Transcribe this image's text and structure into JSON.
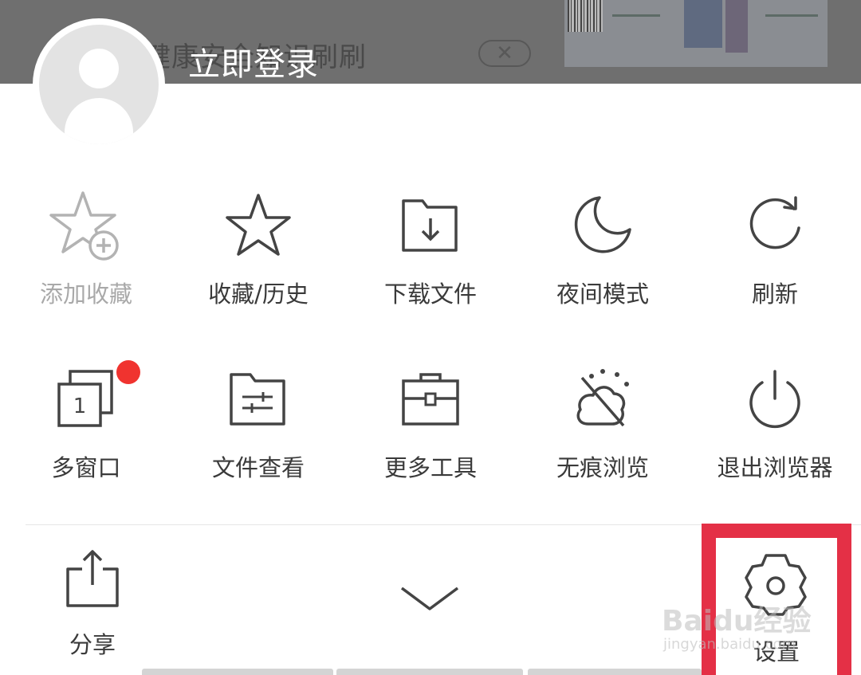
{
  "background": {
    "text": "健康安全知识刷刷",
    "close_glyph": "✕"
  },
  "account": {
    "login_label": "立即登录"
  },
  "menu": {
    "row1": [
      {
        "label": "添加收藏",
        "icon": "star-add-icon",
        "disabled": true
      },
      {
        "label": "收藏/历史",
        "icon": "star-icon"
      },
      {
        "label": "下载文件",
        "icon": "download-folder-icon"
      },
      {
        "label": "夜间模式",
        "icon": "moon-icon"
      },
      {
        "label": "刷新",
        "icon": "refresh-icon"
      }
    ],
    "row2": [
      {
        "label": "多窗口",
        "icon": "multi-window-icon",
        "window_count": "1",
        "has_badge": true
      },
      {
        "label": "文件查看",
        "icon": "file-view-icon"
      },
      {
        "label": "更多工具",
        "icon": "toolbox-icon"
      },
      {
        "label": "无痕浏览",
        "icon": "incognito-icon"
      },
      {
        "label": "退出浏览器",
        "icon": "power-icon"
      }
    ]
  },
  "bottom": {
    "share_label": "分享",
    "collapse_icon": "chevron-down-icon",
    "settings_label": "设置"
  },
  "watermark": {
    "brand": "Baidu经验",
    "url": "jingyan.baidu.com"
  },
  "colors": {
    "highlight": "#e43046",
    "badge": "#f0332f",
    "icon": "#444444",
    "disabled": "#a9a9a9"
  }
}
